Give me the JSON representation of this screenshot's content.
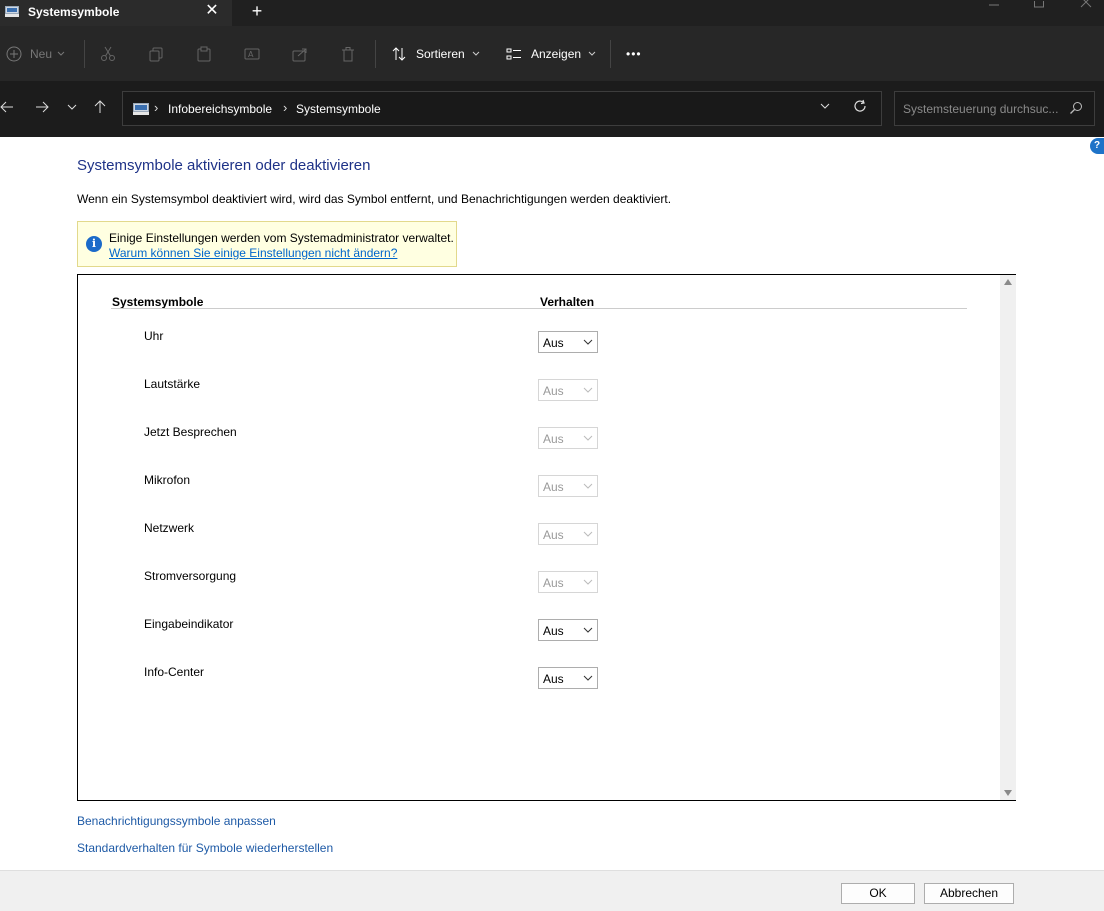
{
  "window": {
    "tab_title": "Systemsymbole",
    "close_glyph": "✕",
    "new_tab_glyph": "+"
  },
  "toolbar": {
    "new_label": "Neu",
    "sort_label": "Sortieren",
    "view_label": "Anzeigen",
    "more_glyph": "•••"
  },
  "address": {
    "breadcrumbs": [
      "Infobereichsymbole",
      "Systemsymbole"
    ],
    "search_placeholder": "Systemsteuerung durchsuc..."
  },
  "help_glyph": "?",
  "page": {
    "title": "Systemsymbole aktivieren oder deaktivieren",
    "description": "Wenn ein Systemsymbol deaktiviert wird, wird das Symbol entfernt, und Benachrichtigungen werden deaktiviert."
  },
  "info": {
    "glyph": "i",
    "text": "Einige Einstellungen werden vom Systemadministrator verwaltet.",
    "link": "Warum können Sie einige Einstellungen nicht ändern?"
  },
  "table": {
    "col_symbol": "Systemsymbole",
    "col_behavior": "Verhalten",
    "rows": [
      {
        "label": "Uhr",
        "value": "Aus",
        "enabled": true
      },
      {
        "label": "Lautstärke",
        "value": "Aus",
        "enabled": false
      },
      {
        "label": "Jetzt Besprechen",
        "value": "Aus",
        "enabled": false
      },
      {
        "label": "Mikrofon",
        "value": "Aus",
        "enabled": false
      },
      {
        "label": "Netzwerk",
        "value": "Aus",
        "enabled": false
      },
      {
        "label": "Stromversorgung",
        "value": "Aus",
        "enabled": false
      },
      {
        "label": "Eingabeindikator",
        "value": "Aus",
        "enabled": true
      },
      {
        "label": "Info-Center",
        "value": "Aus",
        "enabled": true
      }
    ]
  },
  "links": {
    "customize": "Benachrichtigungssymbole anpassen",
    "restore": "Standardverhalten für Symbole wiederherstellen"
  },
  "buttons": {
    "ok": "OK",
    "cancel": "Abbrechen"
  },
  "colors": {
    "title_blue": "#1e3287",
    "link_blue": "#1e5aa6",
    "info_yellow": "#ffffe1",
    "dark_chrome": "#202020"
  }
}
